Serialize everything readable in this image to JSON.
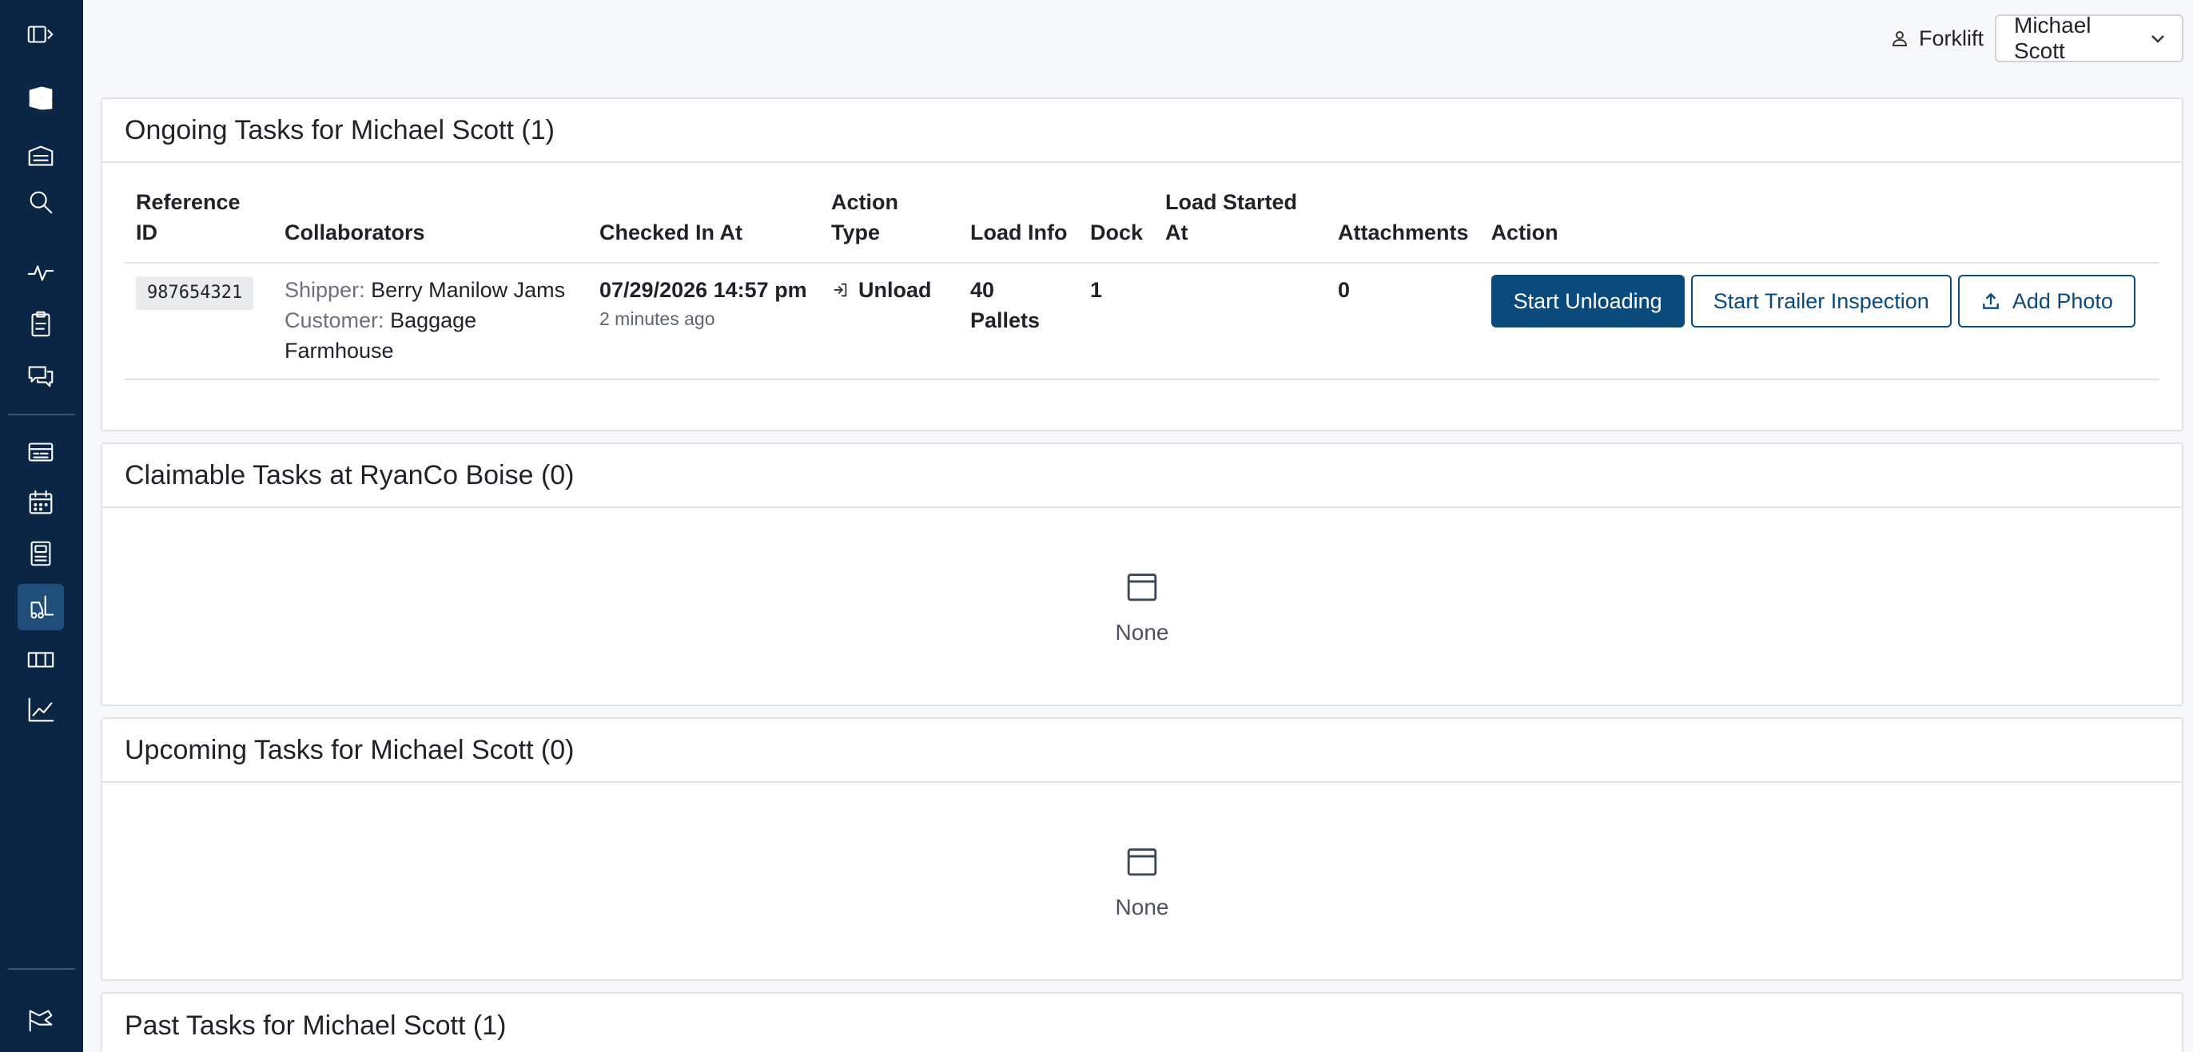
{
  "topbar": {
    "role_label": "Forklift",
    "user_select_value": "Michael Scott"
  },
  "sidebar": {
    "items": [
      {
        "name": "toggle-sidebar"
      },
      {
        "name": "logo"
      },
      {
        "name": "warehouse"
      },
      {
        "name": "search"
      },
      {
        "name": "activity"
      },
      {
        "name": "clipboard"
      },
      {
        "name": "messages"
      },
      {
        "name": "loads"
      },
      {
        "name": "calendar"
      },
      {
        "name": "docks"
      },
      {
        "name": "forklift"
      },
      {
        "name": "tickets"
      },
      {
        "name": "analytics"
      },
      {
        "name": "tour"
      }
    ]
  },
  "ongoing": {
    "title": "Ongoing Tasks for Michael Scott (1)",
    "columns": {
      "reference_id": "Reference ID",
      "collaborators": "Collaborators",
      "checked_in_at": "Checked In At",
      "action_type": "Action Type",
      "load_info": "Load Info",
      "dock": "Dock",
      "load_started_at": "Load Started At",
      "attachments": "Attachments",
      "action": "Action"
    },
    "rows": [
      {
        "reference_id": "987654321",
        "shipper_label": "Shipper:",
        "shipper": "Berry Manilow Jams",
        "customer_label": "Customer:",
        "customer": "Baggage Farmhouse",
        "checked_in_at": "07/29/2026 14:57 pm",
        "checked_in_relative": "2 minutes ago",
        "action_type": "Unload",
        "load_info": "40 Pallets",
        "dock": "1",
        "load_started_at": "",
        "attachments": "0",
        "buttons": {
          "start_unloading": "Start Unloading",
          "start_trailer_inspection": "Start Trailer Inspection",
          "add_photo": "Add Photo"
        }
      }
    ]
  },
  "claimable": {
    "title": "Claimable Tasks at RyanCo Boise (0)",
    "empty_label": "None"
  },
  "upcoming": {
    "title": "Upcoming Tasks for Michael Scott (0)",
    "empty_label": "None"
  },
  "past": {
    "title": "Past Tasks for Michael Scott (1)"
  }
}
